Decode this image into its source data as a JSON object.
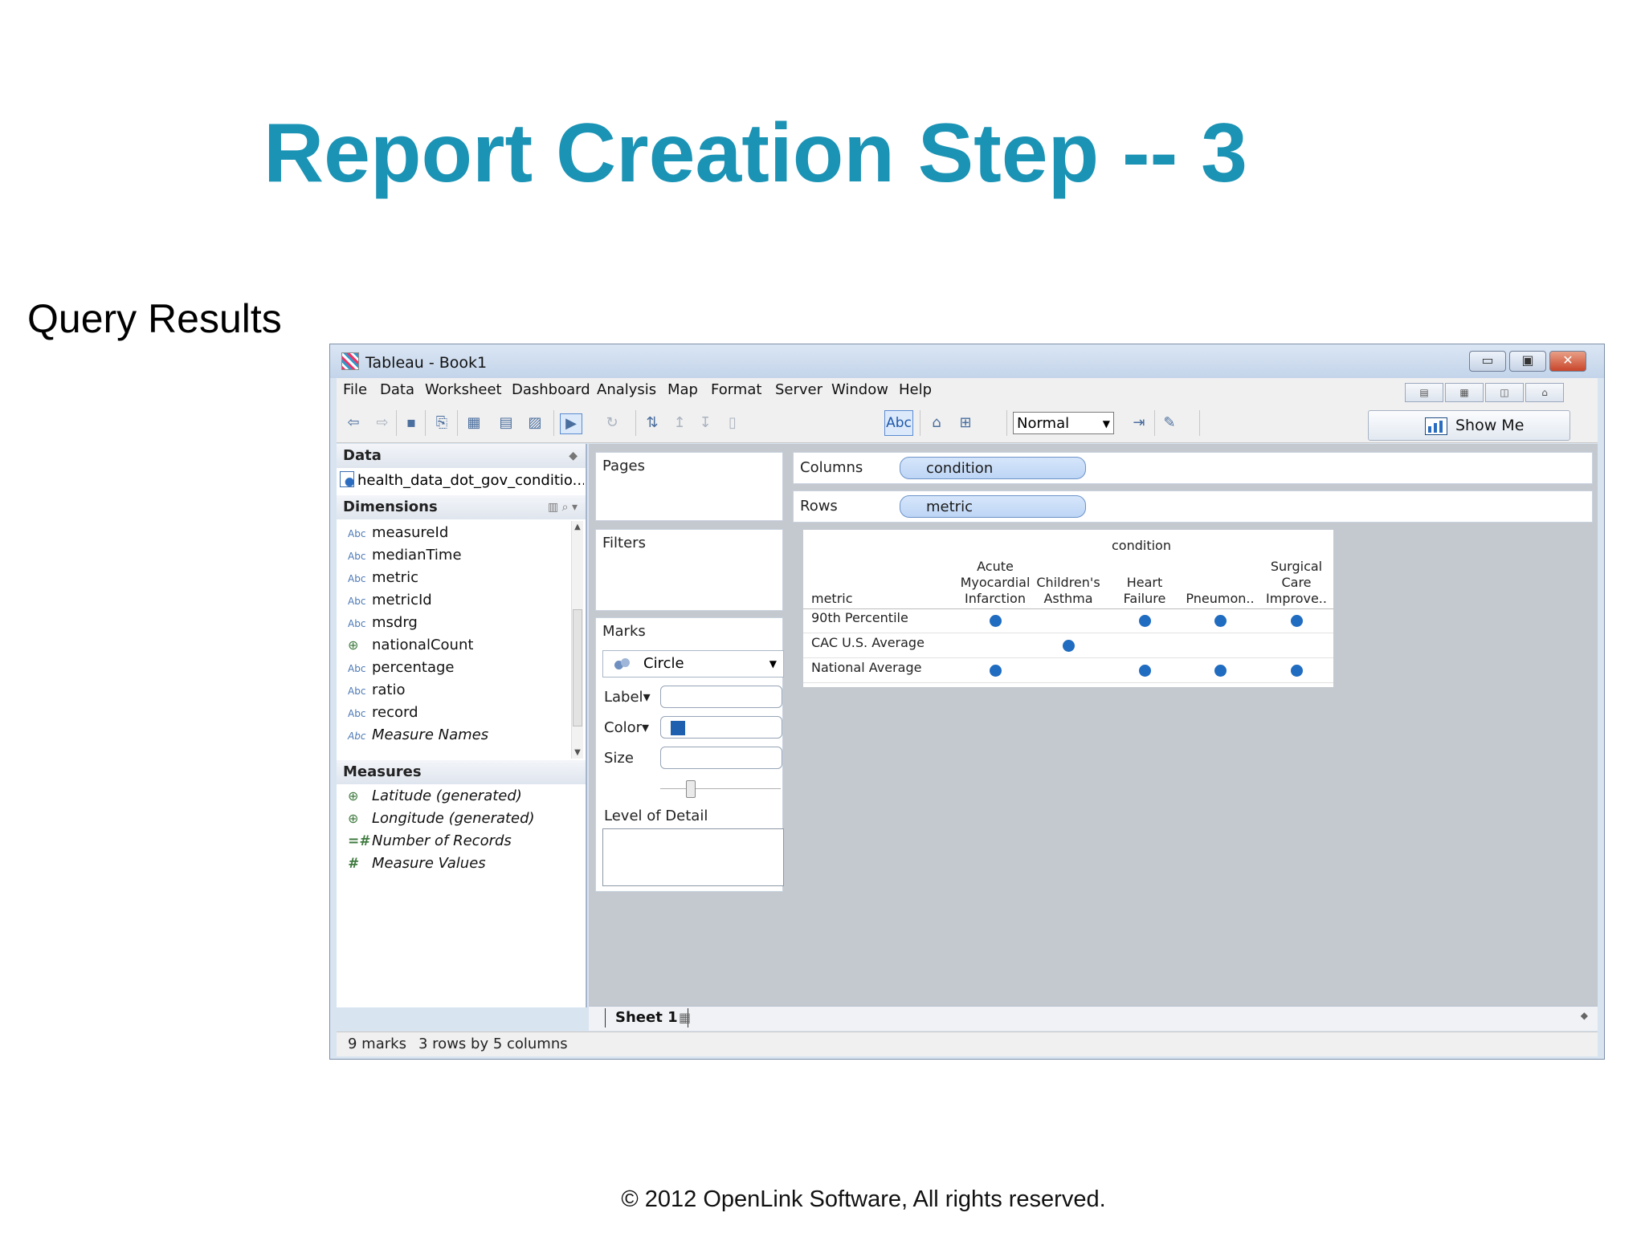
{
  "slide": {
    "title": "Report Creation Step -- 3",
    "subtitle": "Query Results",
    "footer": "© 2012 OpenLink Software, All rights reserved."
  },
  "window": {
    "title": "Tableau - Book1",
    "controls": [
      "minimize",
      "maximize",
      "close"
    ]
  },
  "menu": [
    "File",
    "Data",
    "Worksheet",
    "Dashboard",
    "Analysis",
    "Map",
    "Format",
    "Server",
    "Window",
    "Help"
  ],
  "toolbar": {
    "abc_label": "Abc",
    "fit_value": "Normal",
    "show_me_label": "Show Me"
  },
  "data_pane": {
    "header": "Data",
    "datasource": "health_data_dot_gov_conditio...",
    "dimensions_header": "Dimensions",
    "dimensions": [
      {
        "type": "Abc",
        "name": "measureId",
        "icon": "abc-icon"
      },
      {
        "type": "Abc",
        "name": "medianTime",
        "icon": "abc-icon"
      },
      {
        "type": "Abc",
        "name": "metric",
        "icon": "abc-icon"
      },
      {
        "type": "Abc",
        "name": "metricId",
        "icon": "abc-icon"
      },
      {
        "type": "Abc",
        "name": "msdrg",
        "icon": "abc-icon"
      },
      {
        "type": "⊕",
        "name": "nationalCount",
        "icon": "globe-icon"
      },
      {
        "type": "Abc",
        "name": "percentage",
        "icon": "abc-icon"
      },
      {
        "type": "Abc",
        "name": "ratio",
        "icon": "abc-icon"
      },
      {
        "type": "Abc",
        "name": "record",
        "icon": "abc-icon"
      },
      {
        "type": "Abc",
        "name": "Measure Names",
        "icon": "abc-icon"
      }
    ],
    "measures_header": "Measures",
    "measures": [
      {
        "type": "⊕",
        "name": "Latitude (generated)",
        "icon": "globe-icon"
      },
      {
        "type": "⊕",
        "name": "Longitude (generated)",
        "icon": "globe-icon"
      },
      {
        "type": "=#",
        "name": "Number of Records",
        "icon": "hash-icon"
      },
      {
        "type": "#",
        "name": "Measure Values",
        "icon": "hash-icon"
      }
    ]
  },
  "shelves": {
    "pages": "Pages",
    "filters": "Filters",
    "columns_label": "Columns",
    "columns_pill": "condition",
    "rows_label": "Rows",
    "rows_pill": "metric"
  },
  "marks": {
    "header": "Marks",
    "mark_type": "Circle",
    "label": "Label",
    "color": "Color",
    "size": "Size",
    "level_of_detail": "Level of Detail",
    "color_value": "#1f5fb0"
  },
  "viz": {
    "column_field": "condition",
    "row_field": "metric",
    "columns": [
      [
        "Acute",
        "Myocardial",
        "Infarction"
      ],
      [
        "Children's",
        "Asthma"
      ],
      [
        "Heart",
        "Failure"
      ],
      [
        "Pneumon.."
      ],
      [
        "Surgical",
        "Care",
        "Improve.."
      ]
    ],
    "rows": [
      "90th Percentile",
      "CAC U.S. Average",
      "National Average"
    ],
    "marks_present": [
      [
        true,
        false,
        true,
        true,
        true
      ],
      [
        false,
        true,
        false,
        false,
        false
      ],
      [
        true,
        false,
        true,
        true,
        true
      ]
    ],
    "mark_color": "#1f6cc0"
  },
  "sheets": {
    "active": "Sheet 1"
  },
  "status": {
    "marks": "9 marks",
    "dimensions": "3 rows by 5 columns"
  }
}
